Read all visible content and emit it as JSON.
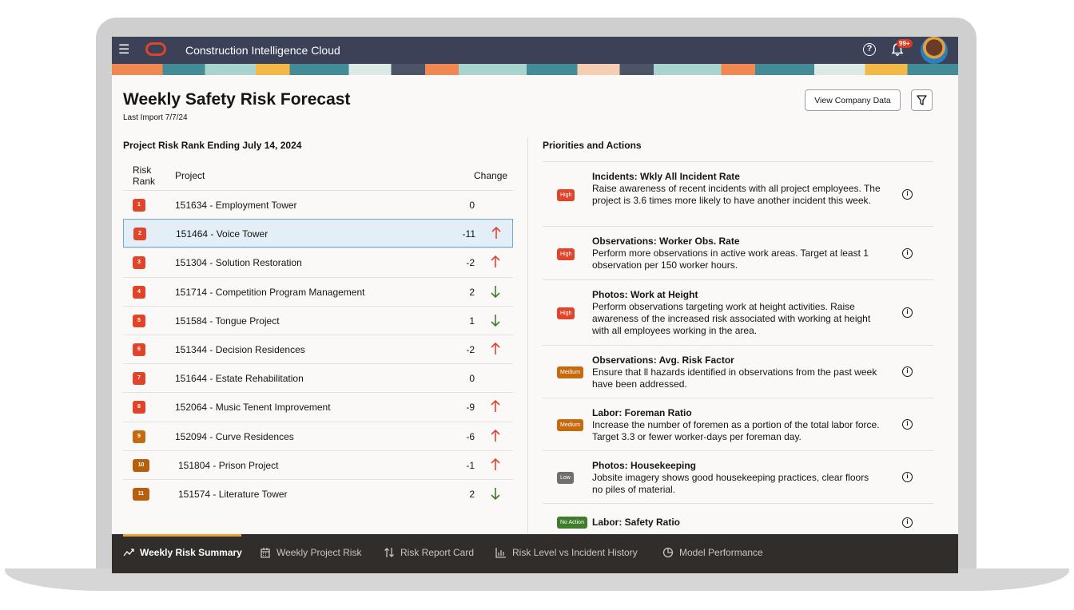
{
  "app": {
    "title": "Construction Intelligence Cloud",
    "notification_count": "99+"
  },
  "page": {
    "title": "Weekly Safety Risk Forecast",
    "last_import": "Last Import 7/7/24",
    "view_company_label": "View Company Data"
  },
  "risk_table": {
    "title": "Project Risk Rank Ending July 14, 2024",
    "headers": {
      "rank": "Risk Rank",
      "project": "Project",
      "change": "Change"
    },
    "rows": [
      {
        "rank": "1",
        "project": "151634 - Employment Tower",
        "change": "0",
        "direction": "none",
        "color": "#e0452b"
      },
      {
        "rank": "2",
        "project": "151464 - Voice Tower",
        "change": "-11",
        "direction": "up",
        "color": "#e0452b"
      },
      {
        "rank": "3",
        "project": "151304 - Solution Restoration",
        "change": "-2",
        "direction": "up",
        "color": "#e0452b"
      },
      {
        "rank": "4",
        "project": "151714 - Competition Program Management",
        "change": "2",
        "direction": "down",
        "color": "#e0452b"
      },
      {
        "rank": "5",
        "project": "151584 - Tongue Project",
        "change": "1",
        "direction": "down",
        "color": "#e0452b"
      },
      {
        "rank": "6",
        "project": "151344 - Decision Residences",
        "change": "-2",
        "direction": "up",
        "color": "#e0452b"
      },
      {
        "rank": "7",
        "project": "151644 - Estate Rehabilitation",
        "change": "0",
        "direction": "none",
        "color": "#e0452b"
      },
      {
        "rank": "8",
        "project": "152064 - Music Tenent Improvement",
        "change": "-9",
        "direction": "up",
        "color": "#e0452b"
      },
      {
        "rank": "9",
        "project": "152094 - Curve Residences",
        "change": "-6",
        "direction": "up",
        "color": "#c66a10"
      },
      {
        "rank": "10",
        "project": "151804 - Prison Project",
        "change": "-1",
        "direction": "up",
        "color": "#b85f0d"
      },
      {
        "rank": "11",
        "project": "151574 - Literature Tower",
        "change": "2",
        "direction": "down",
        "color": "#b85f0d"
      }
    ]
  },
  "priorities": {
    "title": "Priorities and Actions",
    "items": [
      {
        "level": "High",
        "color": "#e0452b",
        "title": "Incidents: Wkly All Incident Rate",
        "desc": "Raise awareness of recent incidents with all project employees. The project is 3.6 times more likely to have another incident this week."
      },
      {
        "level": "High",
        "color": "#e0452b",
        "title": "Observations: Worker Obs. Rate",
        "desc": "Perform more observations in active work areas. Target at least 1 observation per 150 worker hours."
      },
      {
        "level": "High",
        "color": "#e0452b",
        "title": "Photos: Work at Height",
        "desc": "Perform observations targeting work at height activities. Raise awareness of the increased risk associated with working at height with all employees working in the area."
      },
      {
        "level": "Medium",
        "color": "#c66a10",
        "title": "Observations: Avg. Risk Factor",
        "desc": "Ensure that ll hazards identified in observations from the past week have been addressed."
      },
      {
        "level": "Medium",
        "color": "#c66a10",
        "title": "Labor: Foreman Ratio",
        "desc": "Increase the number of foremen as a portion of the total labor force. Target 3.3 or fewer worker-days per foreman day."
      },
      {
        "level": "Low",
        "color": "#6f6f6f",
        "title": "Photos: Housekeeping",
        "desc": "Jobsite imagery shows good housekeeping practices, clear floors no piles of material."
      },
      {
        "level": "No Action",
        "color": "#3f7d2b",
        "title": "Labor: Safety Ratio",
        "desc": ""
      }
    ]
  },
  "bottom_nav": {
    "items": [
      {
        "label": "Weekly Risk Summary",
        "icon": "trend-icon",
        "active": true
      },
      {
        "label": "Weekly Project Risk",
        "icon": "calendar-icon",
        "active": false
      },
      {
        "label": "Risk Report Card",
        "icon": "sort-arrows-icon",
        "active": false
      },
      {
        "label": "Risk Level vs Incident History",
        "icon": "bar-chart-icon",
        "active": false
      },
      {
        "label": "Model Performance",
        "icon": "gear-chart-icon",
        "active": false
      }
    ]
  }
}
